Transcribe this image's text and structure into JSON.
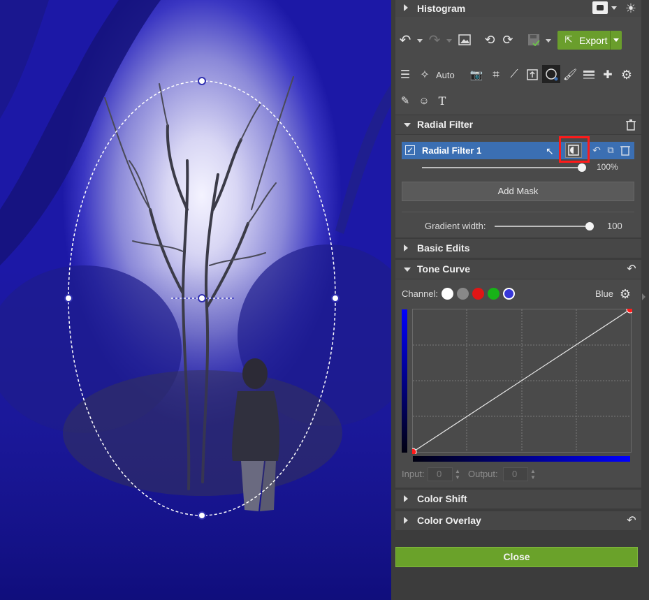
{
  "panel": {
    "histogram": {
      "title": "Histogram"
    },
    "toolbar": {
      "export_label": "Export",
      "tools_row_auto": "Auto"
    },
    "radial_filter": {
      "title": "Radial Filter",
      "filter_name": "Radial Filter 1",
      "opacity": "100%",
      "add_mask_label": "Add Mask",
      "gradient_width_label": "Gradient width:",
      "gradient_width_value": "100"
    },
    "basic_edits": {
      "title": "Basic Edits"
    },
    "tone_curve": {
      "title": "Tone Curve",
      "channel_label": "Channel:",
      "channel_value": "Blue",
      "input_label": "Input:",
      "input_value": "0",
      "output_label": "Output:",
      "output_value": "0"
    },
    "color_shift": {
      "title": "Color Shift"
    },
    "color_overlay": {
      "title": "Color Overlay"
    },
    "close_label": "Close"
  },
  "colors": {
    "accent_green": "#6aa22a",
    "selection_blue": "#3b6fb3",
    "highlight_red": "#ff1a1a",
    "curve_blue": "#0000ff"
  }
}
